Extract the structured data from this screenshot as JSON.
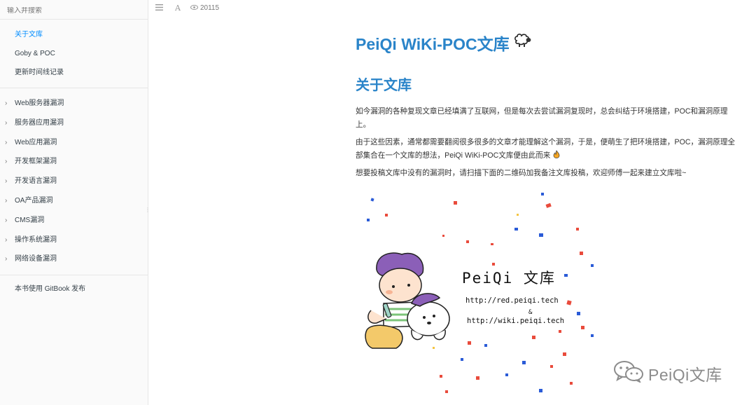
{
  "search": {
    "placeholder": "输入并搜索"
  },
  "sidebar": {
    "top_items": [
      {
        "label": "关于文库"
      },
      {
        "label": "Goby & POC"
      },
      {
        "label": "更新时间线记录"
      }
    ],
    "chapters": [
      {
        "label": "Web服务器漏洞"
      },
      {
        "label": "服务器应用漏洞"
      },
      {
        "label": "Web应用漏洞"
      },
      {
        "label": "开发框架漏洞"
      },
      {
        "label": "开发语言漏洞"
      },
      {
        "label": "OA产品漏洞"
      },
      {
        "label": "CMS漏洞"
      },
      {
        "label": "操作系统漏洞"
      },
      {
        "label": "网络设备漏洞"
      }
    ],
    "footer": "本书使用 GitBook 发布"
  },
  "toolbar": {
    "menu_icon": "hamburger-icon",
    "font_icon": "font-settings-icon",
    "font_glyph": "A",
    "views_icon": "eye-icon",
    "views_count": "20115"
  },
  "page": {
    "title": "PeiQi WiKi-POC文库",
    "section_title": "关于文库",
    "paragraphs": [
      "如今漏洞的各种复现文章已经填满了互联网，但是每次去尝试漏洞复现时，总会纠结于环境搭建，POC和漏洞原理上。",
      "由于这些因素，通常都需要翻阅很多很多的文章才能理解这个漏洞，于是，便萌生了把环境搭建，POC，漏洞原理全部集合在一个文库的想法，PeiQi WiKi-POC文库便由此而来",
      "想要投稿文库中没有的漏洞时，请扫描下面的二维码加我备注文库投稿，欢迎师傅一起来建立文库啦~"
    ]
  },
  "poster": {
    "title": "PeiQi 文库",
    "url1": "http://red.peiqi.tech",
    "amp": "&",
    "url2": "http://wiki.peiqi.tech"
  },
  "watermark": {
    "text": "PeiQi文库"
  },
  "colors": {
    "accent": "#2a84c9",
    "active_link": "#008cff",
    "sidebar_bg": "#fafafa"
  }
}
